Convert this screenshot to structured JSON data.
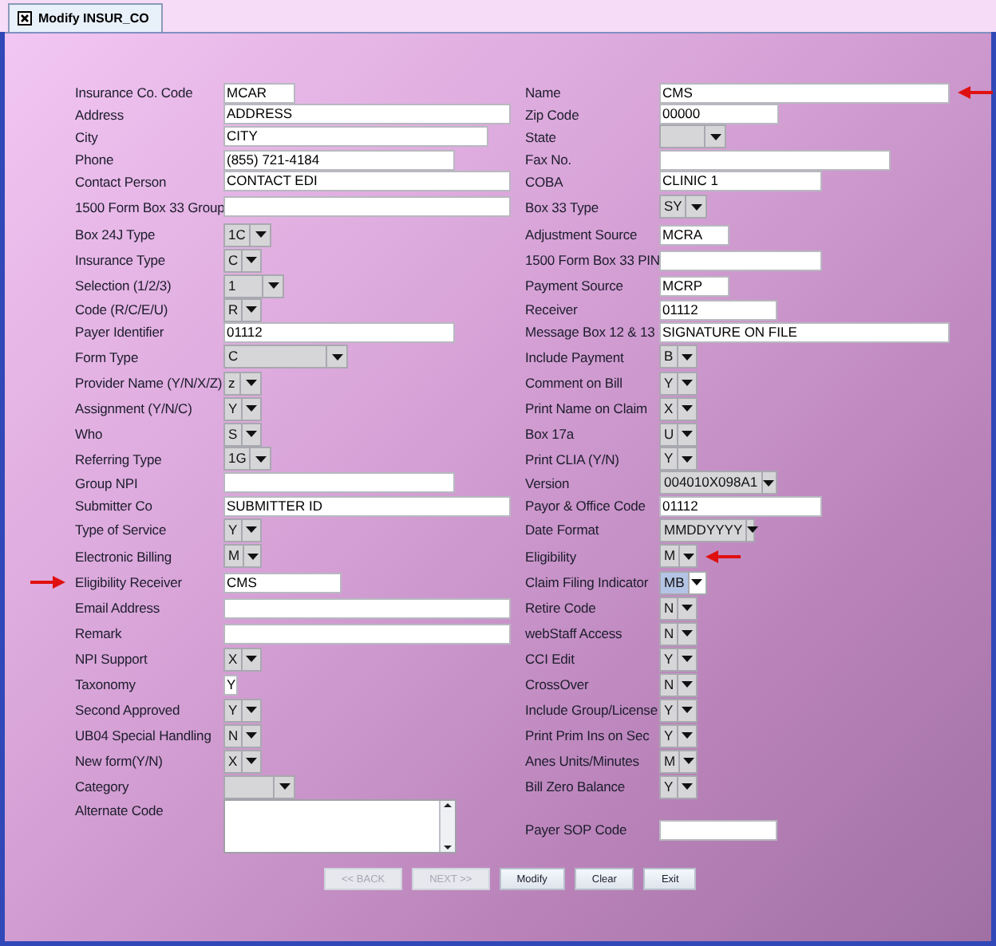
{
  "tab": {
    "title": "Modify INSUR_CO"
  },
  "rows": [
    {
      "left": {
        "label": "Insurance Co. Code",
        "kind": "text",
        "value": "MCAR"
      },
      "right": {
        "label": "Name",
        "kind": "text",
        "value": "CMS",
        "pointer_arrow": true
      }
    },
    {
      "left": {
        "label": "Address",
        "kind": "text",
        "value": "ADDRESS"
      },
      "right": {
        "label": "Zip Code",
        "kind": "text",
        "value": "00000"
      }
    },
    {
      "left": {
        "label": "City",
        "kind": "text",
        "value": "CITY"
      },
      "right": {
        "label": "State",
        "kind": "select"
      }
    },
    {
      "left": {
        "label": "Phone",
        "kind": "text",
        "value": "(855) 721-4184"
      },
      "right": {
        "label": "Fax No.",
        "kind": "text"
      }
    },
    {
      "left": {
        "label": "Contact Person",
        "kind": "text",
        "value": "CONTACT EDI"
      },
      "right": {
        "label": "COBA",
        "kind": "text",
        "value": "CLINIC 1"
      }
    },
    {
      "left": {
        "label": "1500 Form Box 33 Group",
        "kind": "text"
      },
      "right": {
        "label": "Box 33 Type",
        "kind": "select",
        "value": "SY"
      }
    },
    {
      "left": {
        "label": "Box 24J Type",
        "kind": "select",
        "value": "1C"
      },
      "right": {
        "label": "Adjustment Source",
        "kind": "text",
        "value": "MCRA"
      }
    },
    {
      "left": {
        "label": "Insurance Type",
        "kind": "select",
        "value": "C"
      },
      "right": {
        "label": "1500 Form Box 33 PIN",
        "kind": "text"
      }
    },
    {
      "left": {
        "label": "Selection (1/2/3)",
        "kind": "select",
        "value": "1"
      },
      "right": {
        "label": "Payment Source",
        "kind": "text",
        "value": "MCRP"
      }
    },
    {
      "left": {
        "label": "Code (R/C/E/U)",
        "kind": "select",
        "value": "R"
      },
      "right": {
        "label": "Receiver",
        "kind": "text",
        "value": "01112"
      }
    },
    {
      "left": {
        "label": "Payer Identifier",
        "kind": "text",
        "value": "01112"
      },
      "right": {
        "label": "Message Box 12 & 13",
        "kind": "text",
        "value": "SIGNATURE ON FILE"
      }
    },
    {
      "left": {
        "label": "Form Type",
        "kind": "select",
        "value": "C"
      },
      "right": {
        "label": "Include Payment",
        "kind": "select",
        "value": "B"
      }
    },
    {
      "left": {
        "label": "Provider Name (Y/N/X/Z)",
        "kind": "select",
        "value": "z"
      },
      "right": {
        "label": "Comment on Bill",
        "kind": "select",
        "value": "Y"
      }
    },
    {
      "left": {
        "label": "Assignment (Y/N/C)",
        "kind": "select",
        "value": "Y"
      },
      "right": {
        "label": "Print Name on Claim",
        "kind": "select",
        "value": "X"
      }
    },
    {
      "left": {
        "label": "Who",
        "kind": "select",
        "value": "S"
      },
      "right": {
        "label": "Box 17a",
        "kind": "select",
        "value": "U"
      }
    },
    {
      "left": {
        "label": "Referring Type",
        "kind": "select",
        "value": "1G"
      },
      "right": {
        "label": "Print CLIA (Y/N)",
        "kind": "select",
        "value": "Y"
      }
    },
    {
      "left": {
        "label": "Group NPI",
        "kind": "text"
      },
      "right": {
        "label": "Version",
        "kind": "select",
        "value": "004010X098A1"
      }
    },
    {
      "left": {
        "label": "Submitter Co",
        "kind": "text",
        "value": "SUBMITTER ID"
      },
      "right": {
        "label": "Payor & Office Code",
        "kind": "text",
        "value": "01112"
      }
    },
    {
      "left": {
        "label": "Type of Service",
        "kind": "select",
        "value": "Y"
      },
      "right": {
        "label": "Date Format",
        "kind": "select",
        "value": "MMDDYYYY"
      }
    },
    {
      "left": {
        "label": "Electronic Billing",
        "kind": "select",
        "value": "M"
      },
      "right": {
        "label": "Eligibility",
        "kind": "select",
        "value": "M",
        "pointer_arrow": true
      }
    },
    {
      "left": {
        "label": "Eligibility Receiver",
        "kind": "text",
        "value": "CMS",
        "pointer_arrow": true
      },
      "right": {
        "label": "Claim Filing Indicator",
        "kind": "select",
        "value": "MB",
        "focused": true
      }
    },
    {
      "left": {
        "label": "Email Address",
        "kind": "text"
      },
      "right": {
        "label": "Retire Code",
        "kind": "select",
        "value": "N"
      }
    },
    {
      "left": {
        "label": "Remark",
        "kind": "text"
      },
      "right": {
        "label": "webStaff Access",
        "kind": "select",
        "value": "N"
      }
    },
    {
      "left": {
        "label": "NPI Support",
        "kind": "select",
        "value": "X"
      },
      "right": {
        "label": "CCI Edit",
        "kind": "select",
        "value": "Y"
      }
    },
    {
      "left": {
        "label": "Taxonomy",
        "kind": "text",
        "value": "Y"
      },
      "right": {
        "label": "CrossOver",
        "kind": "select",
        "value": "N"
      }
    },
    {
      "left": {
        "label": "Second Approved",
        "kind": "select",
        "value": "Y"
      },
      "right": {
        "label": "Include Group/License",
        "kind": "select",
        "value": "Y"
      }
    },
    {
      "left": {
        "label": "UB04 Special Handling",
        "kind": "select",
        "value": "N"
      },
      "right": {
        "label": "Print Prim Ins on Sec",
        "kind": "select",
        "value": "Y"
      }
    },
    {
      "left": {
        "label": "New form(Y/N)",
        "kind": "select",
        "value": "X"
      },
      "right": {
        "label": "Anes Units/Minutes",
        "kind": "select",
        "value": "M"
      }
    },
    {
      "left": {
        "label": "Category",
        "kind": "select"
      },
      "right": {
        "label": "Bill Zero Balance",
        "kind": "select",
        "value": "Y"
      }
    },
    {
      "left": {
        "label": "Alternate Code",
        "kind": "textarea"
      },
      "right": {
        "label": "Payer SOP Code",
        "kind": "text"
      }
    }
  ],
  "buttons": [
    {
      "label": "<< BACK",
      "disabled": true
    },
    {
      "label": "NEXT >>",
      "disabled": true
    },
    {
      "label": "Modify",
      "disabled": false
    },
    {
      "label": "Clear",
      "disabled": false
    },
    {
      "label": "Exit",
      "disabled": false
    }
  ]
}
